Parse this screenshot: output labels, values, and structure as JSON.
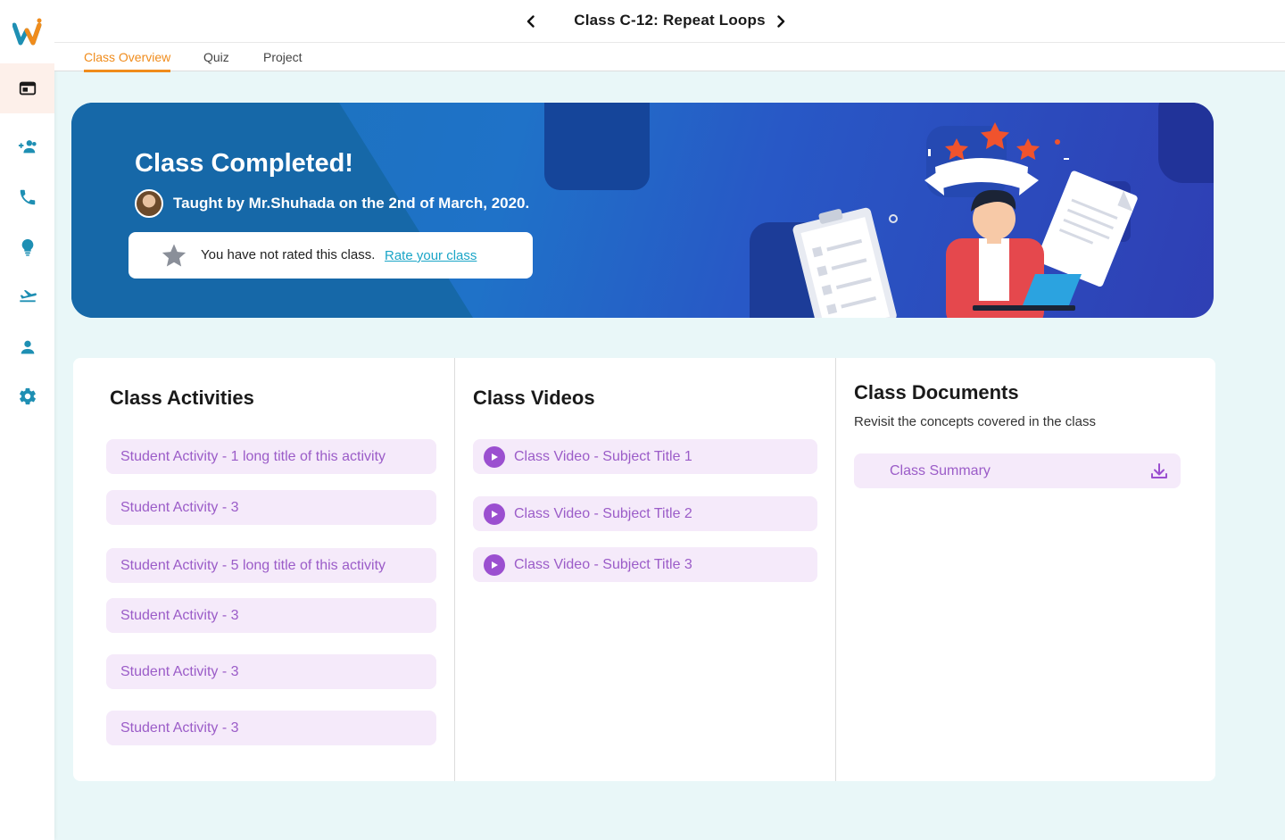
{
  "app": {
    "logo_letter": "w"
  },
  "sidebar": {
    "items": [
      {
        "icon": "class-icon",
        "active": true
      },
      {
        "icon": "add-group-icon"
      },
      {
        "icon": "phone-icon"
      },
      {
        "icon": "lightbulb-icon"
      },
      {
        "icon": "flight-icon"
      },
      {
        "icon": "person-icon"
      },
      {
        "icon": "gear-icon"
      }
    ]
  },
  "header": {
    "title": "Class C-12: Repeat Loops"
  },
  "tabs": [
    {
      "label": "Class Overview",
      "active": true
    },
    {
      "label": "Quiz"
    },
    {
      "label": "Project"
    }
  ],
  "banner": {
    "title": "Class Completed!",
    "teacher_line": "Taught by Mr.Shuhada on the 2nd of March, 2020.",
    "rating_text": "You have not rated this class.",
    "rating_link": "Rate your class"
  },
  "activities": {
    "title": "Class Activities",
    "items": [
      "Student Activity - 1 long title of this activity",
      "Student Activity - 3",
      "Student Activity - 5 long title of this activity",
      "Student Activity - 3",
      "Student Activity - 3",
      "Student Activity - 3"
    ]
  },
  "videos": {
    "title": "Class Videos",
    "items": [
      "Class Video - Subject Title 1",
      "Class Video - Subject Title 2",
      "Class Video - Subject Title 3"
    ]
  },
  "documents": {
    "title": "Class Documents",
    "subtitle": "Revisit the concepts covered in the class",
    "items": [
      "Class Summary"
    ]
  },
  "colors": {
    "accent": "#f08c1c",
    "sidebar_icon": "#1e8fb3",
    "item_bg": "#f5eafa",
    "item_text": "#9b5cc8",
    "link": "#1aa5c7"
  }
}
